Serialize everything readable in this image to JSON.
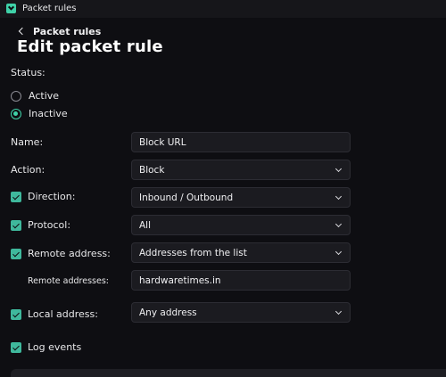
{
  "window": {
    "title": "Packet rules"
  },
  "header": {
    "back_label": "Packet rules",
    "title": "Edit packet rule"
  },
  "status": {
    "label": "Status:",
    "options": [
      {
        "label": "Active",
        "selected": false
      },
      {
        "label": "Inactive",
        "selected": true
      }
    ]
  },
  "form": {
    "name": {
      "label": "Name:",
      "value": "Block URL"
    },
    "action": {
      "label": "Action:",
      "value": "Block"
    },
    "direction": {
      "label": "Direction:",
      "value": "Inbound / Outbound",
      "checked": true
    },
    "protocol": {
      "label": "Protocol:",
      "value": "All",
      "checked": true
    },
    "remote_address": {
      "label": "Remote address:",
      "value": "Addresses from the list",
      "checked": true
    },
    "remote_addresses": {
      "label": "Remote addresses:",
      "value": "hardwaretimes.in"
    },
    "local_address": {
      "label": "Local address:",
      "value": "Any address",
      "checked": true
    },
    "log_events": {
      "label": "Log events",
      "checked": true
    }
  },
  "colors": {
    "accent": "#3fd1a8",
    "background": "#0e0e12",
    "field": "#1b1b20"
  },
  "icons": [
    "app-logo-icon",
    "back-chevron-icon",
    "chevron-down-icon",
    "checkmark-icon"
  ]
}
